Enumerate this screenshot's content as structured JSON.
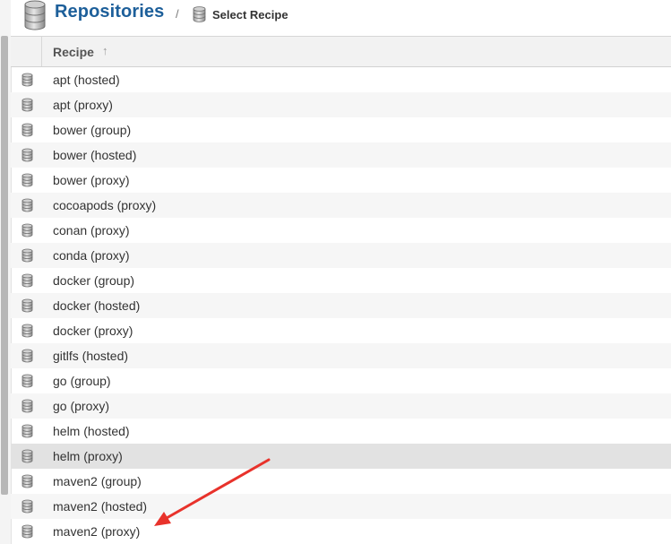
{
  "header": {
    "title": "Repositories",
    "separator": "/",
    "breadcrumb": "Select Recipe"
  },
  "grid": {
    "column_header": "Recipe",
    "sort_indicator": "↑",
    "rows": [
      {
        "label": "apt (hosted)"
      },
      {
        "label": "apt (proxy)"
      },
      {
        "label": "bower (group)"
      },
      {
        "label": "bower (hosted)"
      },
      {
        "label": "bower (proxy)"
      },
      {
        "label": "cocoapods (proxy)"
      },
      {
        "label": "conan (proxy)"
      },
      {
        "label": "conda (proxy)"
      },
      {
        "label": "docker (group)"
      },
      {
        "label": "docker (hosted)"
      },
      {
        "label": "docker (proxy)"
      },
      {
        "label": "gitlfs (hosted)"
      },
      {
        "label": "go (group)"
      },
      {
        "label": "go (proxy)"
      },
      {
        "label": "helm (hosted)"
      },
      {
        "label": "helm (proxy)",
        "selected": true
      },
      {
        "label": "maven2 (group)"
      },
      {
        "label": "maven2 (hosted)"
      },
      {
        "label": "maven2 (proxy)"
      }
    ]
  },
  "colors": {
    "title": "#1d5f9a",
    "annotation_arrow": "#e8322b",
    "selected_row": "#e2e2e2"
  },
  "icons": {
    "row_icon": "database-icon",
    "header_icon": "database-icon"
  }
}
